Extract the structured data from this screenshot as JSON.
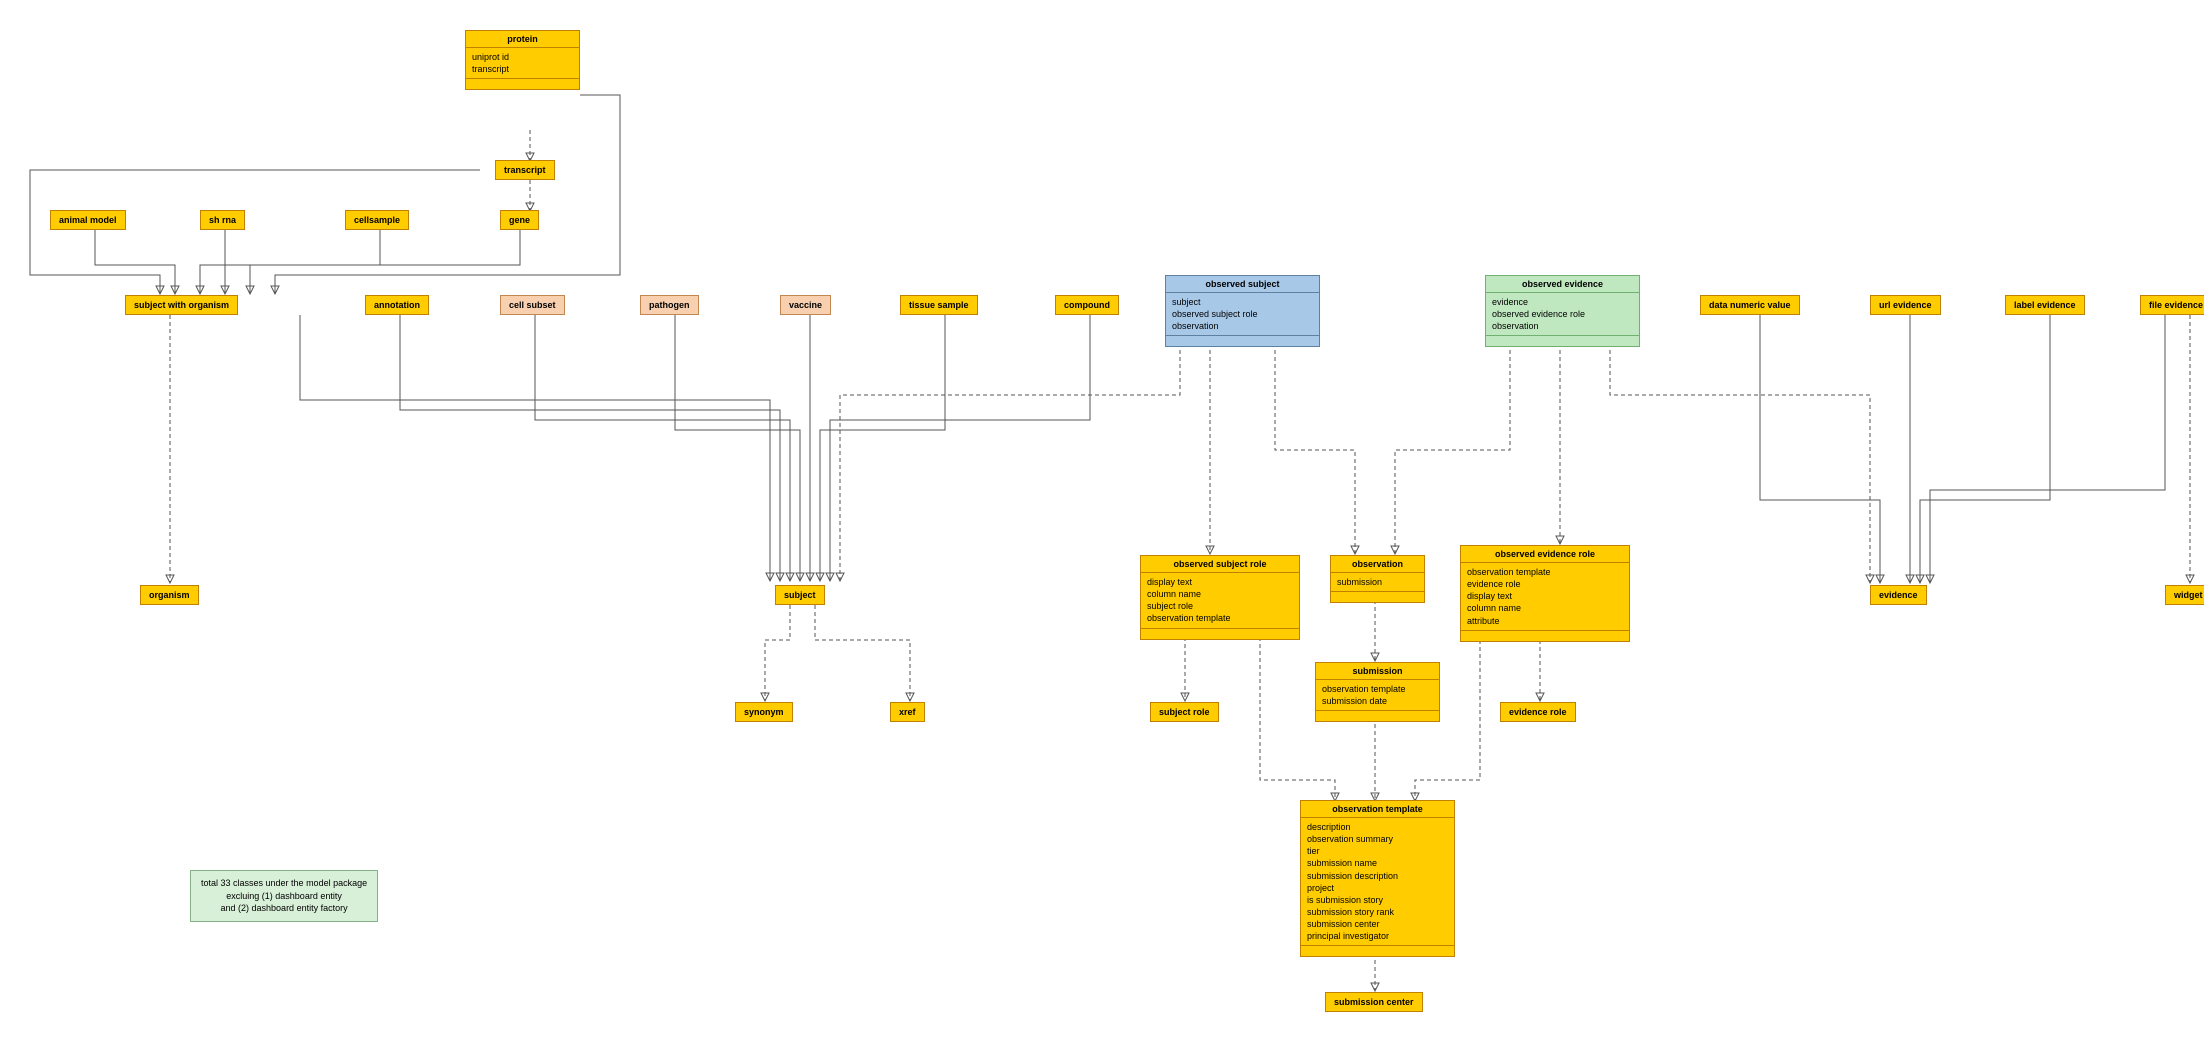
{
  "entities": {
    "protein": {
      "title": "protein",
      "attrs": [
        "uniprot id",
        "transcript"
      ]
    },
    "transcript": {
      "title": "transcript"
    },
    "animal_model": {
      "title": "animal model"
    },
    "sh_rna": {
      "title": "sh rna"
    },
    "cellsample": {
      "title": "cellsample"
    },
    "gene": {
      "title": "gene"
    },
    "subject_with_organism": {
      "title": "subject with organism"
    },
    "annotation": {
      "title": "annotation"
    },
    "cell_subset": {
      "title": "cell subset"
    },
    "pathogen": {
      "title": "pathogen"
    },
    "vaccine": {
      "title": "vaccine"
    },
    "tissue_sample": {
      "title": "tissue sample"
    },
    "compound": {
      "title": "compound"
    },
    "observed_subject": {
      "title": "observed subject",
      "attrs": [
        "subject",
        "observed subject role",
        "observation"
      ]
    },
    "observed_evidence": {
      "title": "observed evidence",
      "attrs": [
        "evidence",
        "observed evidence role",
        "observation"
      ]
    },
    "data_numeric_value": {
      "title": "data numeric value"
    },
    "url_evidence": {
      "title": "url evidence"
    },
    "label_evidence": {
      "title": "label evidence"
    },
    "file_evidence": {
      "title": "file evidence"
    },
    "organism": {
      "title": "organism"
    },
    "subject": {
      "title": "subject"
    },
    "observed_subject_role": {
      "title": "observed subject role",
      "attrs": [
        "display text",
        "column name",
        "subject role",
        "observation template"
      ]
    },
    "observation": {
      "title": "observation",
      "attrs": [
        "submission"
      ]
    },
    "observed_evidence_role": {
      "title": "observed evidence role",
      "attrs": [
        "observation template",
        "evidence role",
        "display text",
        "column name",
        "attribute"
      ]
    },
    "evidence": {
      "title": "evidence"
    },
    "widget": {
      "title": "widget"
    },
    "synonym": {
      "title": "synonym"
    },
    "xref": {
      "title": "xref"
    },
    "subject_role": {
      "title": "subject role"
    },
    "submission": {
      "title": "submission",
      "attrs": [
        "observation template",
        "submission date"
      ]
    },
    "evidence_role": {
      "title": "evidence role"
    },
    "observation_template": {
      "title": "observation template",
      "attrs": [
        "description",
        "observation summary",
        "tier",
        "submission name",
        "submission description",
        "project",
        "is submission story",
        "submission story rank",
        "submission center",
        "principal investigator"
      ]
    },
    "submission_center": {
      "title": "submission center"
    }
  },
  "note": {
    "line1": "total 33 classes under the model package",
    "line2": "excluing (1) dashboard entity",
    "line3": "and (2) dashboard entity factory"
  }
}
